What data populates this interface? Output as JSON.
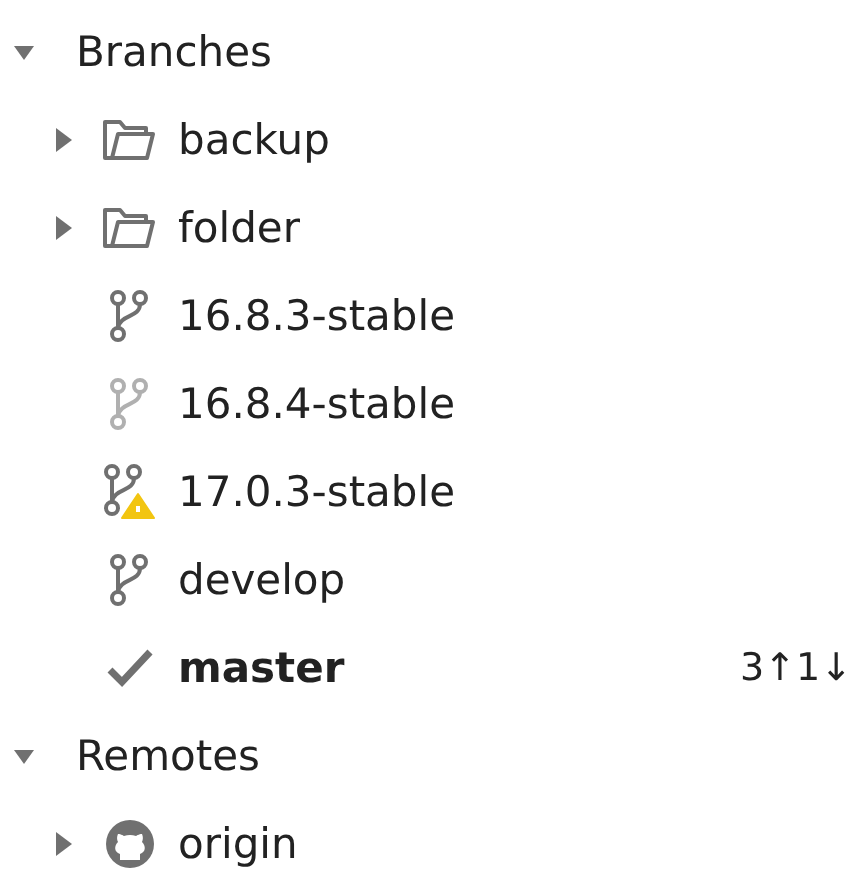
{
  "sections": [
    {
      "label": "Branches",
      "expanded": true,
      "children": [
        {
          "kind": "folder",
          "label": "backup",
          "expanded": false
        },
        {
          "kind": "folder",
          "label": "folder",
          "expanded": false
        },
        {
          "kind": "branch",
          "label": "16.8.3-stable"
        },
        {
          "kind": "branch-light",
          "label": "16.8.4-stable"
        },
        {
          "kind": "branch-warning",
          "label": "17.0.3-stable"
        },
        {
          "kind": "branch",
          "label": "develop"
        },
        {
          "kind": "current",
          "label": "master",
          "sync": "3↑1↓"
        }
      ]
    },
    {
      "label": "Remotes",
      "expanded": true,
      "children": [
        {
          "kind": "remote",
          "label": "origin",
          "expanded": false
        }
      ]
    }
  ]
}
